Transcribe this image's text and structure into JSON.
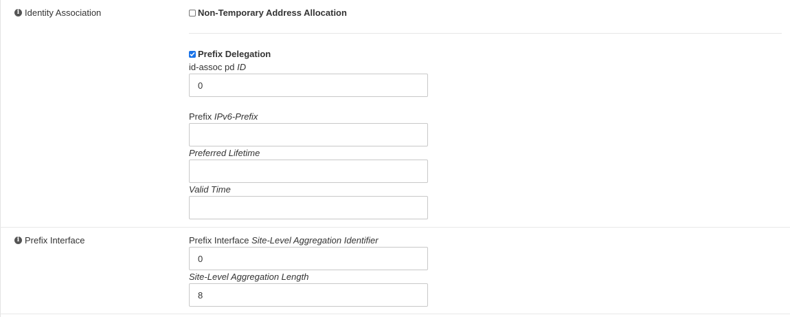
{
  "identity_association": {
    "section_label": "Identity Association",
    "non_temporary": {
      "label": "Non-Temporary Address Allocation",
      "checked": false
    },
    "prefix_delegation": {
      "label": "Prefix Delegation",
      "checked": true
    },
    "id_assoc_pd": {
      "label_prefix": "id-assoc pd",
      "label_em": "ID",
      "value": "0"
    },
    "prefix": {
      "label_prefix": "Prefix",
      "label_em": "IPv6-Prefix",
      "value": ""
    },
    "preferred_lifetime": {
      "label_em": "Preferred Lifetime",
      "value": ""
    },
    "valid_time": {
      "label_em": "Valid Time",
      "value": ""
    }
  },
  "prefix_interface": {
    "section_label": "Prefix Interface",
    "sla_id": {
      "label_prefix": "Prefix Interface",
      "label_em": "Site-Level Aggregation Identifier",
      "value": "0"
    },
    "sla_len": {
      "label_em": "Site-Level Aggregation Length",
      "value": "8"
    }
  },
  "colors": {
    "checkbox_accent": "#1a73e8",
    "border": "#c8c8c8"
  },
  "icons": [
    "info-icon",
    "checkbox-icon"
  ]
}
